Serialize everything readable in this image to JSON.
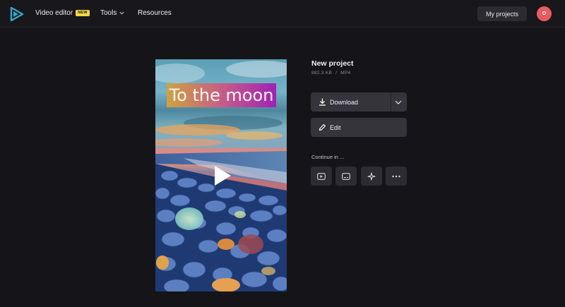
{
  "nav": {
    "video_editor": "Video editor",
    "badge": "NEW",
    "tools": "Tools",
    "resources": "Resources",
    "my_projects": "My projects",
    "avatar_initial": "O"
  },
  "video": {
    "caption": "To the moon"
  },
  "project": {
    "title": "New project",
    "size": "882.3 KB",
    "separator": "/",
    "format": "MP4",
    "download_label": "Download",
    "edit_label": "Edit",
    "continue_label": "Continue in ..."
  },
  "icons": {
    "logo": "clipchamp-logo-icon",
    "tools_chevron": "chevron-down-icon",
    "download": "download-icon",
    "download_more": "chevron-down-icon",
    "edit": "pencil-icon",
    "play": "play-icon",
    "continue": [
      "video-editor-icon",
      "subtitles-icon",
      "sparkles-icon",
      "more-horizontal-icon"
    ]
  },
  "colors": {
    "background": "#151519",
    "topbar": "#18181c",
    "button": "#34343a",
    "badge": "#f3d64a",
    "avatar": "#e85b60",
    "accent_logo": "#3aa5c8"
  }
}
